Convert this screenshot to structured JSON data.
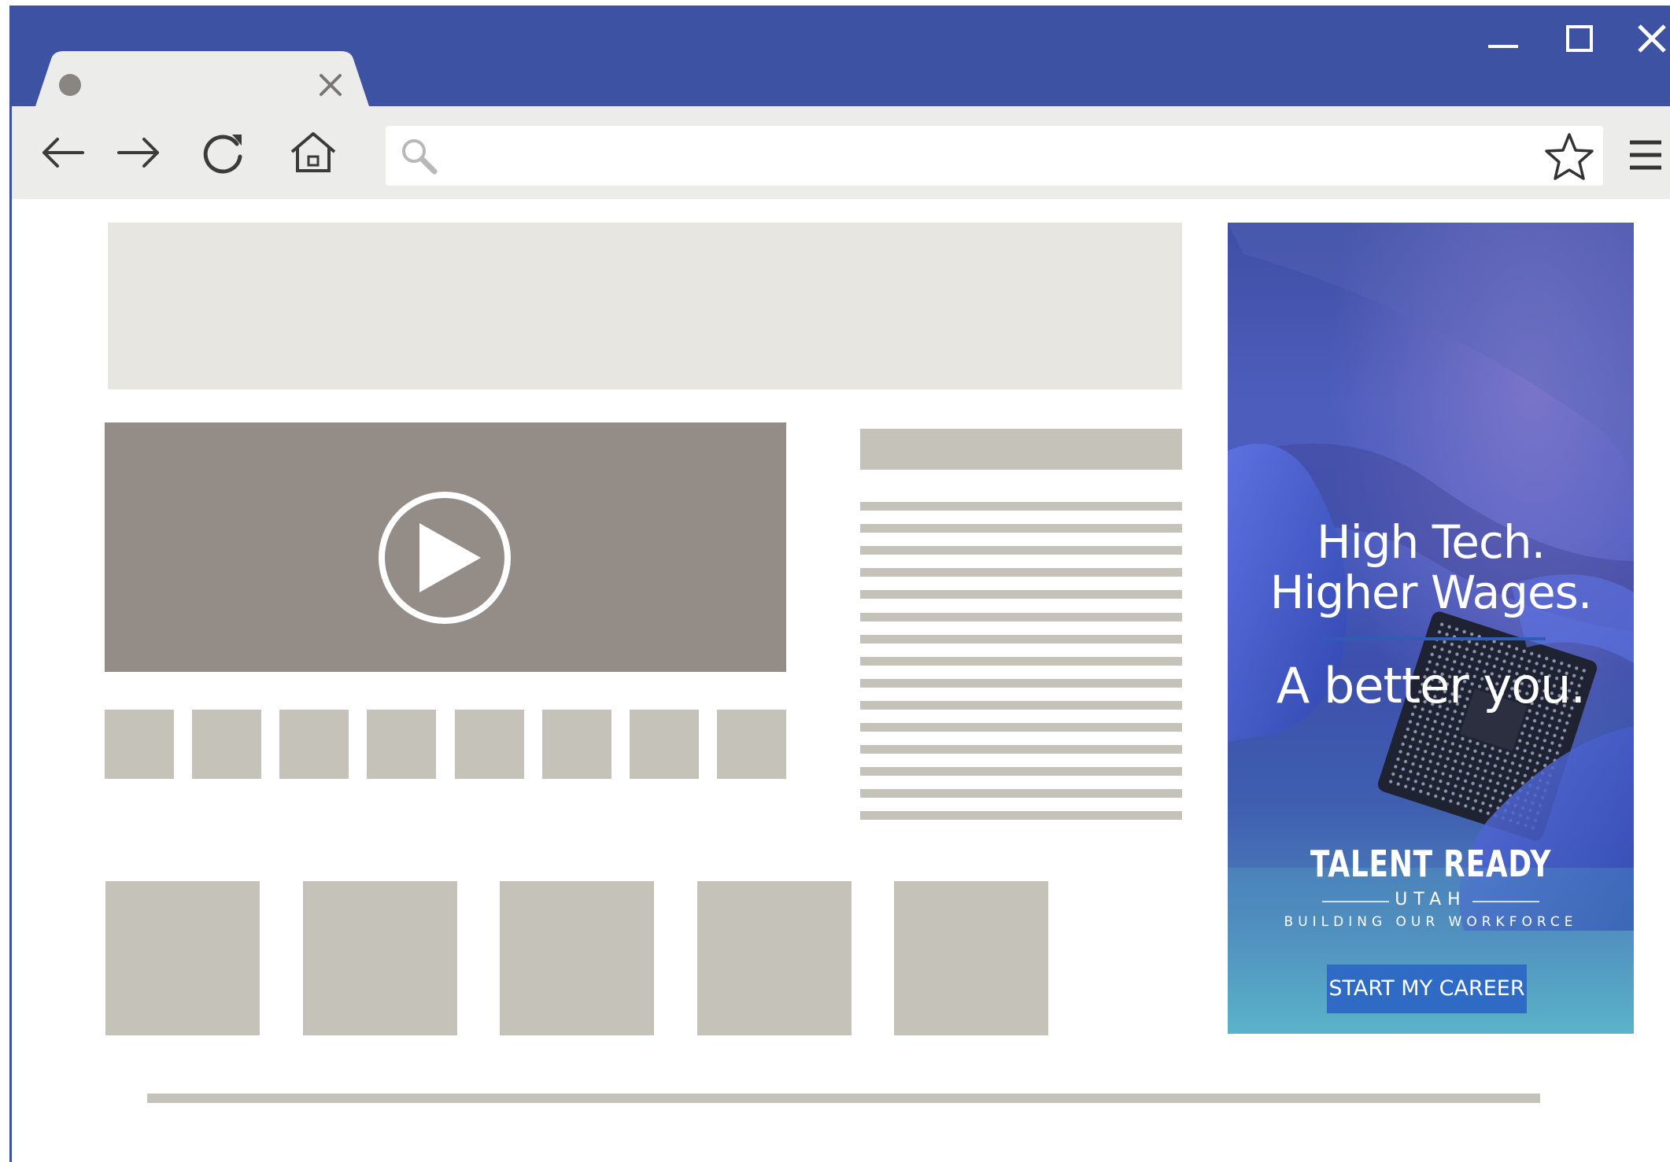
{
  "browser": {
    "tab": {
      "title": ""
    },
    "omnibox": {
      "value": "",
      "placeholder": ""
    },
    "colors": {
      "frame": "#3d52a2",
      "toolbar": "#ececea",
      "tab": "#ececea"
    },
    "icons": {
      "back": "arrow-left-icon",
      "forward": "arrow-right-icon",
      "reload": "reload-icon",
      "home": "home-icon",
      "search": "search-icon",
      "bookmark": "star-icon",
      "menu": "hamburger-menu-icon",
      "minimize": "minimize-icon",
      "maximize": "maximize-icon",
      "close": "close-icon"
    }
  },
  "page": {
    "colors": {
      "placeholder_light": "#e8e6e1",
      "placeholder": "#c5c2b9",
      "video": "#948c86"
    },
    "video": {
      "icon": "play-icon"
    },
    "thumbnails": 8,
    "text_lines": 15,
    "tiles": 5
  },
  "ad": {
    "headline_1": "High Tech.",
    "headline_2": "Higher Wages.",
    "headline_3": "A better you.",
    "brand": "TALENT READY",
    "brand_sub": "UTAH",
    "tagline": "BUILDING OUR WORKFORCE",
    "cta_label": "START MY CAREER",
    "colors": {
      "cta": "#2f6bc4",
      "rule": "#2f5cb5"
    }
  }
}
